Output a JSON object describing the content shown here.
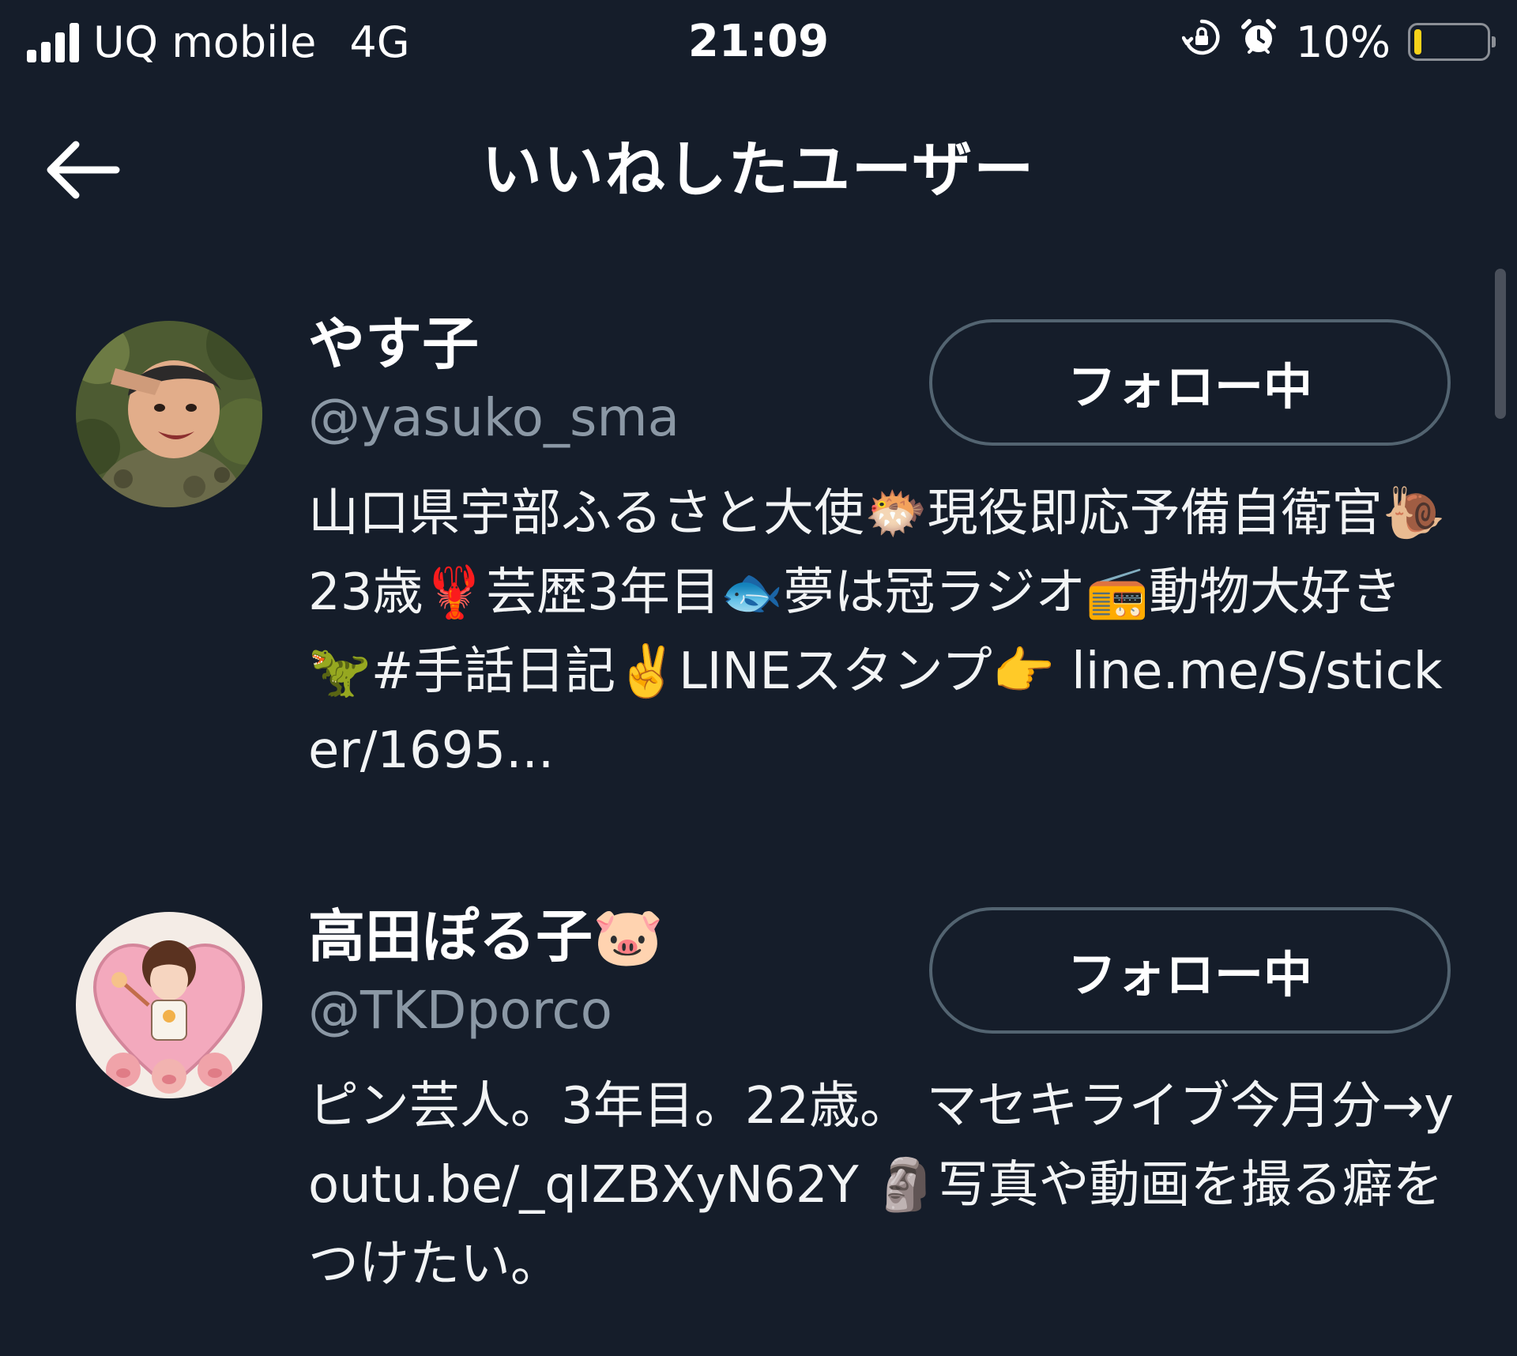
{
  "status_bar": {
    "carrier": "UQ mobile",
    "network": "4G",
    "time": "21:09",
    "battery_percent": "10%",
    "battery_level": 0.1,
    "icons": [
      "cellular-signal-icon",
      "orientation-lock-icon",
      "alarm-icon",
      "battery-icon"
    ]
  },
  "header": {
    "title": "いいねしたユーザー",
    "back_icon": "back-arrow-icon"
  },
  "users": [
    {
      "name": "やす子",
      "handle": "@yasuko_sma",
      "follow_label": "フォロー中",
      "bio": "山口県宇部ふるさと大使🐡現役即応予備自衛官🐌23歳🦞芸歴3年目🐟夢は冠ラジオ📻動物大好き🦖#手話日記✌️LINEスタンプ👉 line.me/S/sticker/1695..."
    },
    {
      "name": "高田ぽる子🐷",
      "handle": "@TKDporco",
      "follow_label": "フォロー中",
      "bio": "ピン芸人。3年目。22歳。 マセキライブ今月分→youtu.be/_qIZBXyN62Y 🗿写真や動画を撮る癖をつけたい。"
    }
  ],
  "colors": {
    "background": "#151d2a",
    "handle_text": "#8b98a5",
    "button_border": "#536471",
    "battery_fill": "#f7d21a"
  }
}
